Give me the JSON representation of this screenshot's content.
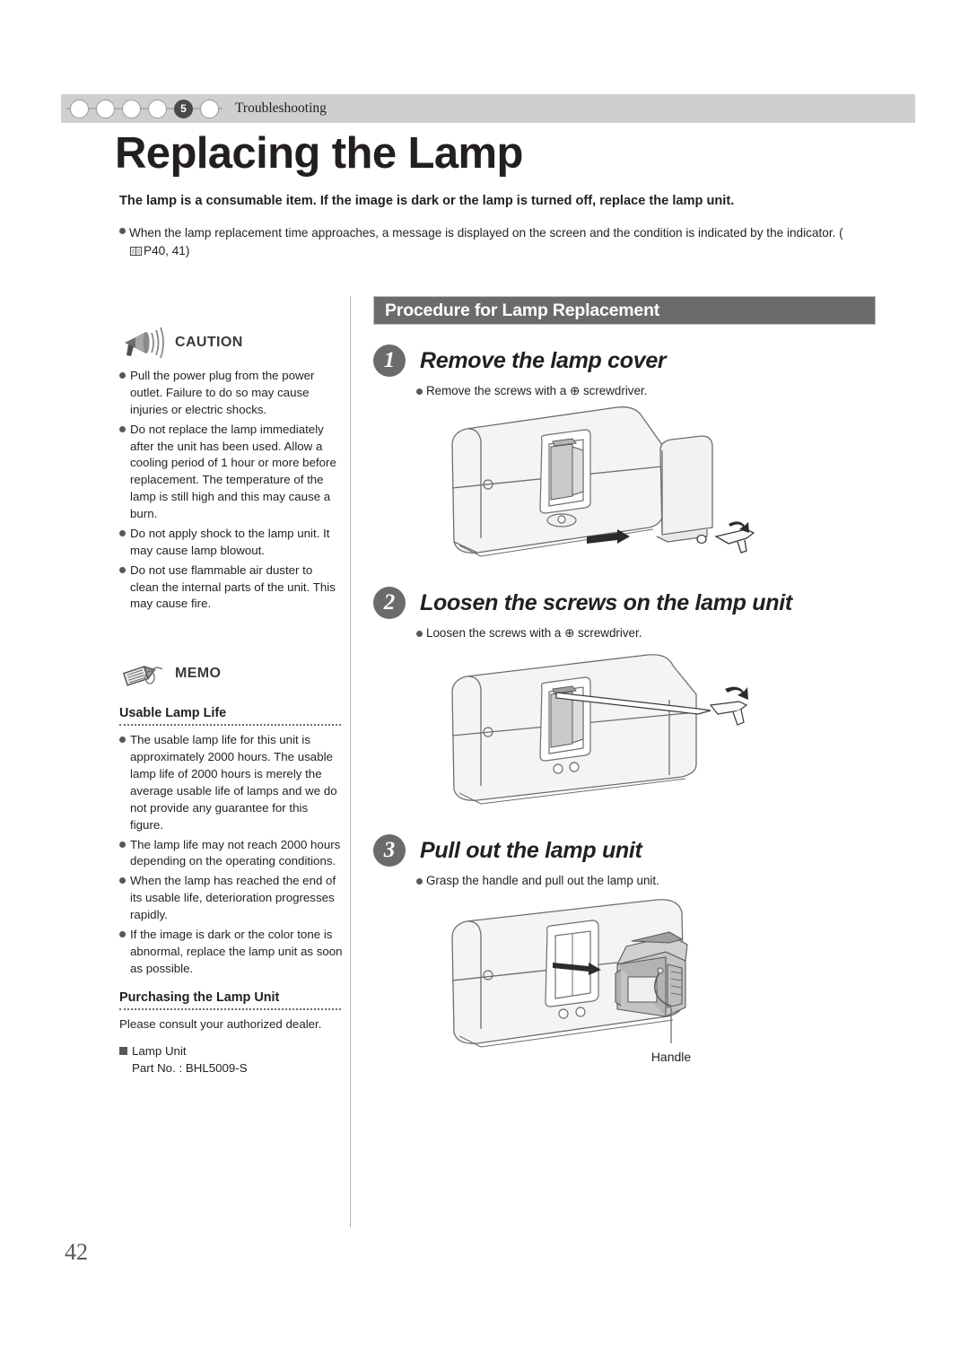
{
  "header": {
    "breadcrumb": {
      "steps": [
        "",
        "",
        "",
        "",
        "5",
        ""
      ],
      "active_index": 4,
      "label": "Troubleshooting"
    }
  },
  "page_title": "Replacing the Lamp",
  "lead": {
    "bold_line": "The lamp is a consumable item. If the image is dark or the lamp is turned off, replace the lamp unit.",
    "bullet": "When the lamp replacement time approaches, a message is displayed on the screen and the condition is indicated by the indicator. (",
    "bullet_ref": "P40, 41",
    "bullet_close": ")"
  },
  "caution": {
    "icon": "megaphone-icon",
    "title": "CAUTION",
    "items": [
      "Pull the power plug from the power outlet. Failure to do so may cause injuries or electric shocks.",
      "Do not replace the lamp immediately after the unit has been used. Allow a cooling period of 1 hour or more before replacement. The temperature of the lamp is still high and this may cause a burn.",
      "Do not apply shock to the lamp unit. It may cause lamp blowout.",
      "Do not use flammable air duster to clean the internal parts of the unit. This may cause fire."
    ]
  },
  "memo": {
    "icon": "pencil-tag-icon",
    "title": "MEMO",
    "sections": [
      {
        "heading": "Usable Lamp Life",
        "items": [
          "The usable lamp life for this unit is approximately 2000 hours. The usable lamp life of 2000 hours is merely the average usable life of lamps and we do not provide any guarantee for this figure.",
          "The lamp life may not reach 2000 hours depending on the operating conditions.",
          "When the lamp has reached the end of its usable life, deterioration progresses rapidly.",
          "If the image is dark or the color tone is abnormal, replace the lamp unit as soon as possible."
        ]
      }
    ],
    "purchasing": {
      "heading": "Purchasing the Lamp Unit",
      "paragraph": "Please consult your authorized dealer.",
      "item_label": "Lamp Unit",
      "item_part": "Part No. : BHL5009-S"
    }
  },
  "procedure": {
    "banner": "Procedure for Lamp Replacement",
    "steps": [
      {
        "number": "1",
        "title": "Remove the lamp cover",
        "note": "Remove the screws with a ⊕ screwdriver.",
        "figure": "projector-lamp-cover-removal-illustration"
      },
      {
        "number": "2",
        "title": "Loosen the screws on the lamp unit",
        "note": "Loosen the screws with a ⊕ screwdriver.",
        "figure": "projector-loosen-screws-illustration"
      },
      {
        "number": "3",
        "title": "Pull out the lamp unit",
        "note": "Grasp the handle and pull out the lamp unit.",
        "figure": "projector-pull-lamp-unit-illustration",
        "callout": "Handle"
      }
    ]
  },
  "page_number": "42",
  "colors": {
    "banner_bg": "#6b6b6b",
    "header_bar_bg": "#cfcfcf",
    "bullet": "#58585a",
    "text": "#231f20"
  }
}
